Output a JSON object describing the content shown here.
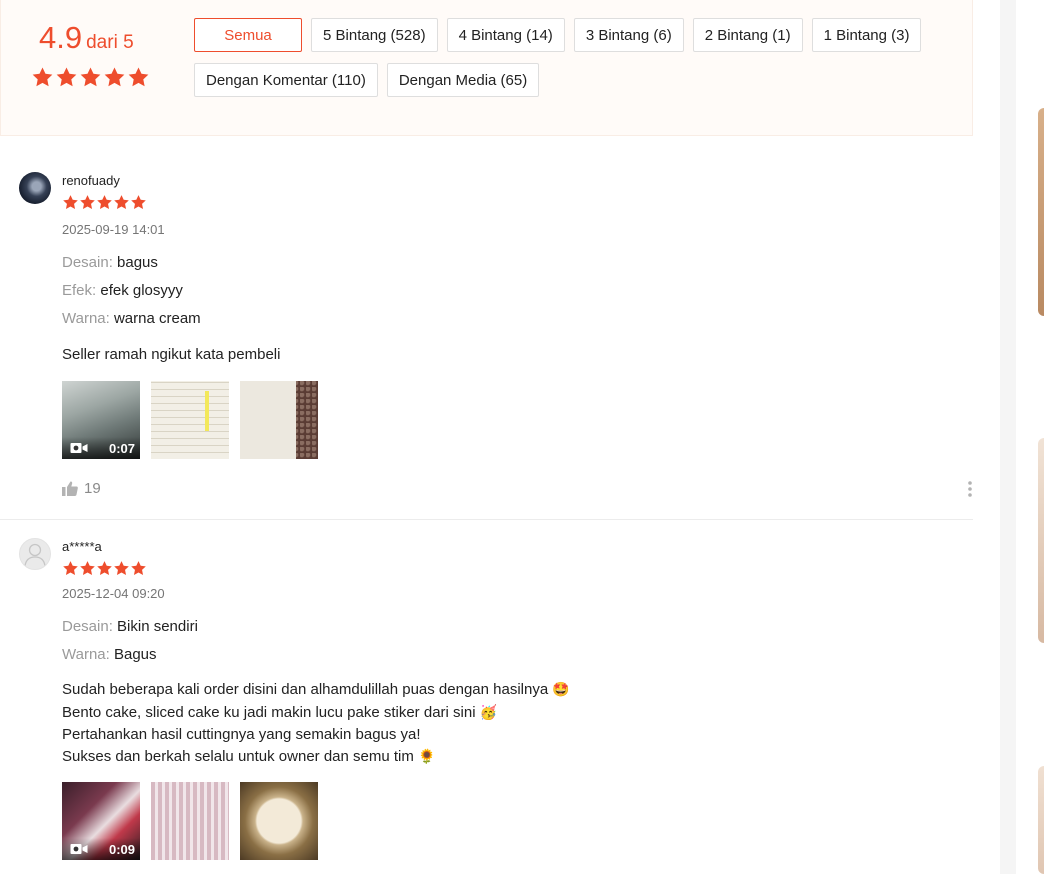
{
  "summary": {
    "score": "4.9",
    "score_suffix": "dari 5",
    "star_color": "#ee4d2d",
    "filters": [
      {
        "label": "Semua",
        "active": true
      },
      {
        "label": "5 Bintang (528)"
      },
      {
        "label": "4 Bintang (14)"
      },
      {
        "label": "3 Bintang (6)"
      },
      {
        "label": "2 Bintang (1)"
      },
      {
        "label": "1 Bintang (3)"
      },
      {
        "label": "Dengan Komentar (110)"
      },
      {
        "label": "Dengan Media (65)"
      }
    ]
  },
  "reviews": [
    {
      "username": "renofuady",
      "rating": 5,
      "date": "2025-09-19 14:01",
      "attrs": [
        {
          "key": "Desain:",
          "value": "bagus"
        },
        {
          "key": "Efek:",
          "value": "efek glosyyy"
        },
        {
          "key": "Warna:",
          "value": "warna cream"
        }
      ],
      "comment": "Seller ramah ngikut kata pembeli",
      "video_duration": "0:07",
      "likes": "19"
    },
    {
      "username": "a*****a",
      "rating": 5,
      "date": "2025-12-04 09:20",
      "attrs": [
        {
          "key": "Desain:",
          "value": "Bikin sendiri"
        },
        {
          "key": "Warna:",
          "value": "Bagus"
        }
      ],
      "comment_lines": [
        "Sudah beberapa kali order disini dan alhamdulillah puas dengan hasilnya",
        "Bento cake, sliced cake ku jadi makin lucu pake stiker dari sini",
        "Pertahankan hasil cuttingnya yang semakin bagus ya!",
        "Sukses dan berkah selalu untuk owner dan semu tim"
      ],
      "video_duration": "0:09"
    }
  ]
}
